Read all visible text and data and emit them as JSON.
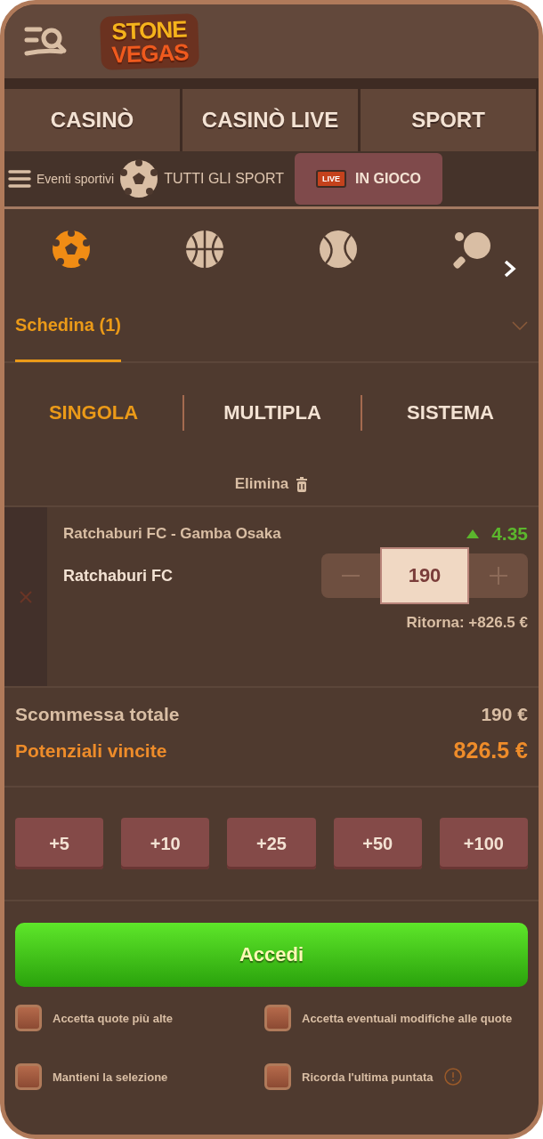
{
  "header": {
    "logo": [
      "STONE",
      "VEGAS"
    ]
  },
  "nav": [
    {
      "label": "CASINÒ",
      "selected": false
    },
    {
      "label": "CASINÒ LIVE",
      "selected": false
    },
    {
      "label": "SPORT",
      "selected": false
    }
  ],
  "subnav": {
    "menu": "Eventi sportivi",
    "all_sports": "TUTTI GLI SPORT",
    "live_badge": "LIVE",
    "live": "IN GIOCO"
  },
  "sports": [
    {
      "kind": "football",
      "selected": true
    },
    {
      "kind": "basketball",
      "selected": false
    },
    {
      "kind": "tennis",
      "selected": false
    },
    {
      "kind": "pingpong",
      "selected": false
    }
  ],
  "betslip": {
    "title": "Schedina (1)",
    "expanded": true
  },
  "bet_types": [
    {
      "label": "SINGOLA",
      "selected": true
    },
    {
      "label": "MULTIPLA",
      "selected": false
    },
    {
      "label": "SISTEMA",
      "selected": false
    }
  ],
  "delete": "Elimina",
  "bet": {
    "event": "Ratchaburi FC - Gamba Osaka",
    "odds": "4.35",
    "odds_rising": true,
    "selection": "Ratchaburi FC",
    "stake": "190",
    "return": "Ritorna: +826.5 €"
  },
  "totals": [
    {
      "label": "Scommessa totale",
      "value": "190 €",
      "highlight": false
    },
    {
      "label": "Potenziali vincite",
      "value": "826.5 €",
      "highlight": true
    }
  ],
  "quick_stakes": [
    "+5",
    "+10",
    "+25",
    "+50",
    "+100"
  ],
  "submit": "Accedi",
  "options": [
    {
      "label": "Accetta quote più alte",
      "checked": false
    },
    {
      "label": "Accetta eventuali modifiche alle quote",
      "checked": false
    },
    {
      "label": "Mantieni la selezione",
      "checked": false
    },
    {
      "label": "Ricorda l'ultima puntata",
      "checked": false,
      "info": true
    }
  ]
}
